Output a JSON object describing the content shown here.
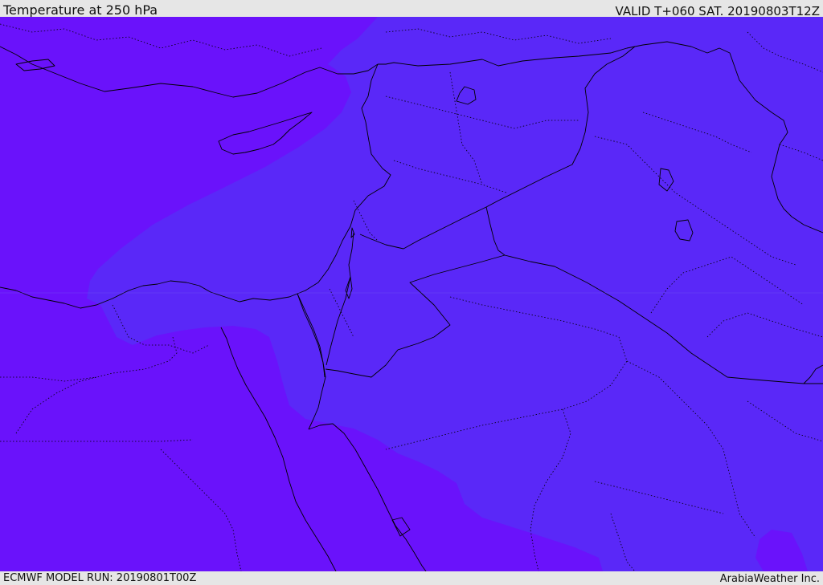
{
  "header": {
    "title": "Temperature at 250 hPa",
    "valid": "VALID T+060 SAT. 20190803T12Z"
  },
  "footer": {
    "model_run": "ECMWF MODEL RUN: 20190801T00Z",
    "credit": "ArabiaWeather Inc."
  },
  "map": {
    "colors": {
      "cold_zone": "#6a12fb",
      "warm_zone": "#5a28f8",
      "coastline": "#000000",
      "border": "#000000"
    }
  }
}
